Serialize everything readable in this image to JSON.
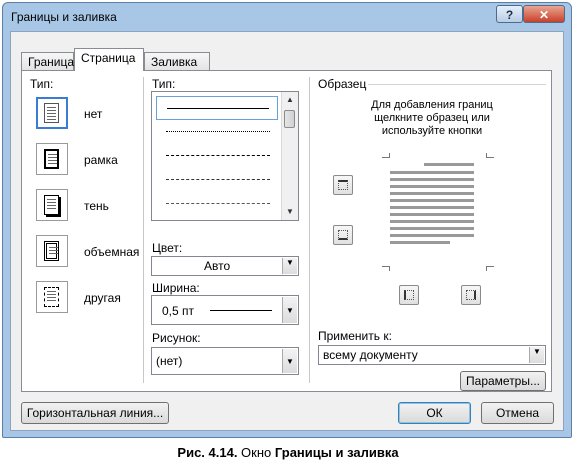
{
  "window": {
    "title": "Границы и заливка",
    "help_glyph": "?",
    "close_glyph": "✕"
  },
  "tabs": [
    {
      "label": "Граница",
      "active": false
    },
    {
      "label": "Страница",
      "active": true
    },
    {
      "label": "Заливка",
      "active": false
    }
  ],
  "setting": {
    "label": "Тип:",
    "items": [
      {
        "label": "нет",
        "selected": true
      },
      {
        "label": "рамка",
        "selected": false
      },
      {
        "label": "тень",
        "selected": false
      },
      {
        "label": "объемная",
        "selected": false
      },
      {
        "label": "другая",
        "selected": false
      }
    ]
  },
  "style": {
    "label": "Тип:",
    "lines": [
      "solid",
      "dotted",
      "dashed-fine",
      "dashed",
      "dash-dot"
    ]
  },
  "color": {
    "label": "Цвет:",
    "value": "Авто"
  },
  "width": {
    "label": "Ширина:",
    "value": "0,5 пт"
  },
  "art": {
    "label": "Рисунок:",
    "value": "(нет)"
  },
  "preview": {
    "label": "Образец",
    "hint_lines": [
      "Для добавления границ",
      "щелкните образец или",
      "используйте кнопки"
    ]
  },
  "apply_to": {
    "label": "Применить к:",
    "value": "всему документу"
  },
  "buttons": {
    "options": "Параметры...",
    "horizontal_line": "Горизонтальная линия...",
    "ok": "ОК",
    "cancel": "Отмена"
  },
  "caption": {
    "prefix": "Рис. 4.14.",
    "middle": " Окно ",
    "bold": "Границы и заливка"
  },
  "colors": {
    "accent": "#3a7bd5",
    "titlebar": "#a8c7e6",
    "close": "#c8412b"
  }
}
